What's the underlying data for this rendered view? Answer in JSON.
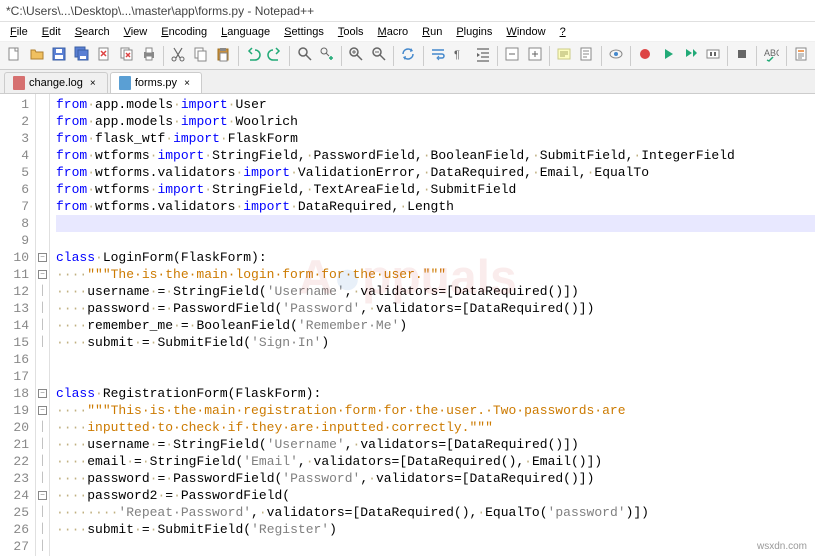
{
  "title": "*C:\\Users\\...\\Desktop\\...\\master\\app\\forms.py - Notepad++",
  "menu": [
    "File",
    "Edit",
    "Search",
    "View",
    "Encoding",
    "Language",
    "Settings",
    "Tools",
    "Macro",
    "Run",
    "Plugins",
    "Window",
    "?"
  ],
  "tabs": [
    {
      "label": "change.log",
      "active": false,
      "red": true
    },
    {
      "label": "forms.py",
      "active": true,
      "red": false
    }
  ],
  "current_line": 8,
  "lines": [
    {
      "n": 1,
      "fold": "",
      "t": [
        [
          "kw",
          "from"
        ],
        [
          "ws",
          "·"
        ],
        [
          "",
          "app.models"
        ],
        [
          "ws",
          "·"
        ],
        [
          "kw",
          "import"
        ],
        [
          "ws",
          "·"
        ],
        [
          "",
          "User"
        ]
      ]
    },
    {
      "n": 2,
      "fold": "",
      "t": [
        [
          "kw",
          "from"
        ],
        [
          "ws",
          "·"
        ],
        [
          "",
          "app.models"
        ],
        [
          "ws",
          "·"
        ],
        [
          "kw",
          "import"
        ],
        [
          "ws",
          "·"
        ],
        [
          "",
          "Woolrich"
        ]
      ]
    },
    {
      "n": 3,
      "fold": "",
      "t": [
        [
          "kw",
          "from"
        ],
        [
          "ws",
          "·"
        ],
        [
          "",
          "flask_wtf"
        ],
        [
          "ws",
          "·"
        ],
        [
          "kw",
          "import"
        ],
        [
          "ws",
          "·"
        ],
        [
          "",
          "FlaskForm"
        ]
      ]
    },
    {
      "n": 4,
      "fold": "",
      "t": [
        [
          "kw",
          "from"
        ],
        [
          "ws",
          "·"
        ],
        [
          "",
          "wtforms"
        ],
        [
          "ws",
          "·"
        ],
        [
          "kw",
          "import"
        ],
        [
          "ws",
          "·"
        ],
        [
          "",
          "StringField,"
        ],
        [
          "ws",
          "·"
        ],
        [
          "",
          "PasswordField,"
        ],
        [
          "ws",
          "·"
        ],
        [
          "",
          "BooleanField,"
        ],
        [
          "ws",
          "·"
        ],
        [
          "",
          "SubmitField,"
        ],
        [
          "ws",
          "·"
        ],
        [
          "",
          "IntegerField"
        ]
      ]
    },
    {
      "n": 5,
      "fold": "",
      "t": [
        [
          "kw",
          "from"
        ],
        [
          "ws",
          "·"
        ],
        [
          "",
          "wtforms.validators"
        ],
        [
          "ws",
          "·"
        ],
        [
          "kw",
          "import"
        ],
        [
          "ws",
          "·"
        ],
        [
          "",
          "ValidationError,"
        ],
        [
          "ws",
          "·"
        ],
        [
          "",
          "DataRequired,"
        ],
        [
          "ws",
          "·"
        ],
        [
          "",
          "Email,"
        ],
        [
          "ws",
          "·"
        ],
        [
          "",
          "EqualTo"
        ]
      ]
    },
    {
      "n": 6,
      "fold": "",
      "t": [
        [
          "kw",
          "from"
        ],
        [
          "ws",
          "·"
        ],
        [
          "",
          "wtforms"
        ],
        [
          "ws",
          "·"
        ],
        [
          "kw",
          "import"
        ],
        [
          "ws",
          "·"
        ],
        [
          "",
          "StringField,"
        ],
        [
          "ws",
          "·"
        ],
        [
          "",
          "TextAreaField,"
        ],
        [
          "ws",
          "·"
        ],
        [
          "",
          "SubmitField"
        ]
      ]
    },
    {
      "n": 7,
      "fold": "",
      "t": [
        [
          "kw",
          "from"
        ],
        [
          "ws",
          "·"
        ],
        [
          "",
          "wtforms.validators"
        ],
        [
          "ws",
          "·"
        ],
        [
          "kw",
          "import"
        ],
        [
          "ws",
          "·"
        ],
        [
          "",
          "DataRequired,"
        ],
        [
          "ws",
          "·"
        ],
        [
          "",
          "Length"
        ]
      ]
    },
    {
      "n": 8,
      "fold": "",
      "t": []
    },
    {
      "n": 9,
      "fold": "",
      "t": []
    },
    {
      "n": 10,
      "fold": "-",
      "t": [
        [
          "kw",
          "class"
        ],
        [
          "ws",
          "·"
        ],
        [
          "",
          "LoginForm"
        ],
        [
          "",
          "(FlaskForm)"
        ],
        [
          "",
          ":"
        ]
      ]
    },
    {
      "n": 11,
      "fold": "-",
      "t": [
        [
          "ws",
          "····"
        ],
        [
          "com",
          "\"\"\"The·is·the·main·login·form·for·the·user.\"\"\""
        ]
      ]
    },
    {
      "n": 12,
      "fold": "|",
      "t": [
        [
          "ws",
          "····"
        ],
        [
          "",
          "username"
        ],
        [
          "ws",
          "·"
        ],
        [
          "",
          "="
        ],
        [
          "ws",
          "·"
        ],
        [
          "",
          "StringField("
        ],
        [
          "str",
          "'Username'"
        ],
        [
          "",
          ","
        ],
        [
          "ws",
          "·"
        ],
        [
          "",
          "validators=[DataRequired()])"
        ]
      ]
    },
    {
      "n": 13,
      "fold": "|",
      "t": [
        [
          "ws",
          "····"
        ],
        [
          "",
          "password"
        ],
        [
          "ws",
          "·"
        ],
        [
          "",
          "="
        ],
        [
          "ws",
          "·"
        ],
        [
          "",
          "PasswordField("
        ],
        [
          "str",
          "'Password'"
        ],
        [
          "",
          ","
        ],
        [
          "ws",
          "·"
        ],
        [
          "",
          "validators=[DataRequired()])"
        ]
      ]
    },
    {
      "n": 14,
      "fold": "|",
      "t": [
        [
          "ws",
          "····"
        ],
        [
          "",
          "remember_me"
        ],
        [
          "ws",
          "·"
        ],
        [
          "",
          "="
        ],
        [
          "ws",
          "·"
        ],
        [
          "",
          "BooleanField("
        ],
        [
          "str",
          "'Remember·Me'"
        ],
        [
          "",
          ")"
        ]
      ]
    },
    {
      "n": 15,
      "fold": "|",
      "t": [
        [
          "ws",
          "····"
        ],
        [
          "",
          "submit"
        ],
        [
          "ws",
          "·"
        ],
        [
          "",
          "="
        ],
        [
          "ws",
          "·"
        ],
        [
          "",
          "SubmitField("
        ],
        [
          "str",
          "'Sign·In'"
        ],
        [
          "",
          ")"
        ]
      ]
    },
    {
      "n": 16,
      "fold": "",
      "t": []
    },
    {
      "n": 17,
      "fold": "",
      "t": []
    },
    {
      "n": 18,
      "fold": "-",
      "t": [
        [
          "kw",
          "class"
        ],
        [
          "ws",
          "·"
        ],
        [
          "",
          "RegistrationForm"
        ],
        [
          "",
          "(FlaskForm)"
        ],
        [
          "",
          ":"
        ]
      ]
    },
    {
      "n": 19,
      "fold": "-",
      "t": [
        [
          "ws",
          "····"
        ],
        [
          "com",
          "\"\"\"This·is·the·main·registration·form·for·the·user.·Two·passwords·are"
        ]
      ]
    },
    {
      "n": 20,
      "fold": "|",
      "t": [
        [
          "ws",
          "····"
        ],
        [
          "com",
          "inputted·to·check·if·they·are·inputted·correctly.\"\"\""
        ]
      ]
    },
    {
      "n": 21,
      "fold": "|",
      "t": [
        [
          "ws",
          "····"
        ],
        [
          "",
          "username"
        ],
        [
          "ws",
          "·"
        ],
        [
          "",
          "="
        ],
        [
          "ws",
          "·"
        ],
        [
          "",
          "StringField("
        ],
        [
          "str",
          "'Username'"
        ],
        [
          "",
          ","
        ],
        [
          "ws",
          "·"
        ],
        [
          "",
          "validators=[DataRequired()])"
        ]
      ]
    },
    {
      "n": 22,
      "fold": "|",
      "t": [
        [
          "ws",
          "····"
        ],
        [
          "",
          "email"
        ],
        [
          "ws",
          "·"
        ],
        [
          "",
          "="
        ],
        [
          "ws",
          "·"
        ],
        [
          "",
          "StringField("
        ],
        [
          "str",
          "'Email'"
        ],
        [
          "",
          ","
        ],
        [
          "ws",
          "·"
        ],
        [
          "",
          "validators=[DataRequired(),"
        ],
        [
          "ws",
          "·"
        ],
        [
          "",
          "Email()])"
        ]
      ]
    },
    {
      "n": 23,
      "fold": "|",
      "t": [
        [
          "ws",
          "····"
        ],
        [
          "",
          "password"
        ],
        [
          "ws",
          "·"
        ],
        [
          "",
          "="
        ],
        [
          "ws",
          "·"
        ],
        [
          "",
          "PasswordField("
        ],
        [
          "str",
          "'Password'"
        ],
        [
          "",
          ","
        ],
        [
          "ws",
          "·"
        ],
        [
          "",
          "validators=[DataRequired()])"
        ]
      ]
    },
    {
      "n": 24,
      "fold": "-",
      "t": [
        [
          "ws",
          "····"
        ],
        [
          "",
          "password2"
        ],
        [
          "ws",
          "·"
        ],
        [
          "",
          "="
        ],
        [
          "ws",
          "·"
        ],
        [
          "",
          "PasswordField("
        ]
      ]
    },
    {
      "n": 25,
      "fold": "|",
      "t": [
        [
          "ws",
          "········"
        ],
        [
          "str",
          "'Repeat·Password'"
        ],
        [
          "",
          ","
        ],
        [
          "ws",
          "·"
        ],
        [
          "",
          "validators=[DataRequired(),"
        ],
        [
          "ws",
          "·"
        ],
        [
          "",
          "EqualTo("
        ],
        [
          "str",
          "'password'"
        ],
        [
          "",
          ")])"
        ]
      ]
    },
    {
      "n": 26,
      "fold": "|",
      "t": [
        [
          "ws",
          "····"
        ],
        [
          "",
          "submit"
        ],
        [
          "ws",
          "·"
        ],
        [
          "",
          "="
        ],
        [
          "ws",
          "·"
        ],
        [
          "",
          "SubmitField("
        ],
        [
          "str",
          "'Register'"
        ],
        [
          "",
          ")"
        ]
      ]
    },
    {
      "n": 27,
      "fold": "|",
      "t": []
    }
  ],
  "toolbar_icons": [
    "new",
    "open",
    "save",
    "save-all",
    "close",
    "close-all",
    "print",
    "sep",
    "cut",
    "copy",
    "paste",
    "sep",
    "undo",
    "redo",
    "sep",
    "find",
    "replace",
    "sep",
    "zoom-in",
    "zoom-out",
    "sep",
    "sync",
    "sep",
    "wordwrap",
    "allchars",
    "indent",
    "sep",
    "fold-1",
    "fold-2",
    "sep",
    "lang",
    "doc",
    "sep",
    "eye",
    "sep",
    "rec",
    "play",
    "play-sel",
    "stop",
    "sep",
    "rec-stop",
    "sep",
    "spell",
    "sep",
    "page"
  ],
  "watermark": "Appuals",
  "sitemark": "wsxdn.com"
}
